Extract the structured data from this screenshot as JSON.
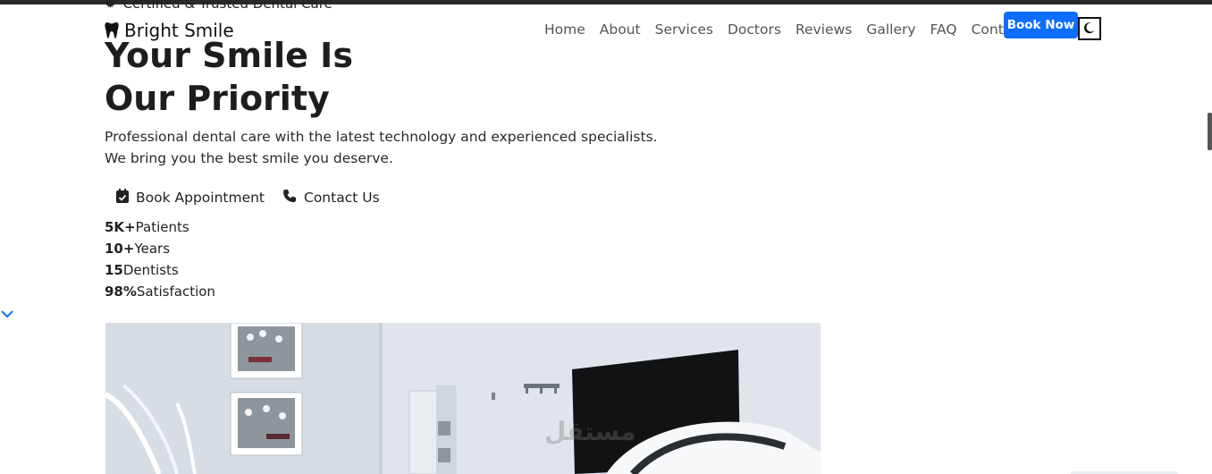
{
  "top_banner": {
    "text": "Certified & Trusted Dental Care",
    "icon": "certificate-icon"
  },
  "brand": {
    "name": "Bright Smile",
    "icon": "tooth-icon"
  },
  "nav": {
    "items": [
      "Home",
      "About",
      "Services",
      "Doctors",
      "Reviews",
      "Gallery",
      "FAQ",
      "Contact"
    ],
    "book_button": "Book Now",
    "theme_toggle_icon": "moon-icon"
  },
  "hero": {
    "title_line1": "Your Smile Is",
    "title_line2": "Our Priority",
    "description": "Professional dental care with the latest technology and experienced specialists. We bring you the best smile you deserve.",
    "cta_primary": "Book Appointment",
    "cta_secondary": "Contact Us",
    "stats": [
      {
        "value": "5K+",
        "label": "Patients"
      },
      {
        "value": "10+",
        "label": "Years"
      },
      {
        "value": "15",
        "label": "Dentists"
      },
      {
        "value": "98%",
        "label": "Satisfaction"
      }
    ]
  },
  "watermark": {
    "text": "مستقل"
  },
  "colors": {
    "primary": "#0d6efd",
    "text": "#1d1d1f",
    "muted": "#555555"
  }
}
